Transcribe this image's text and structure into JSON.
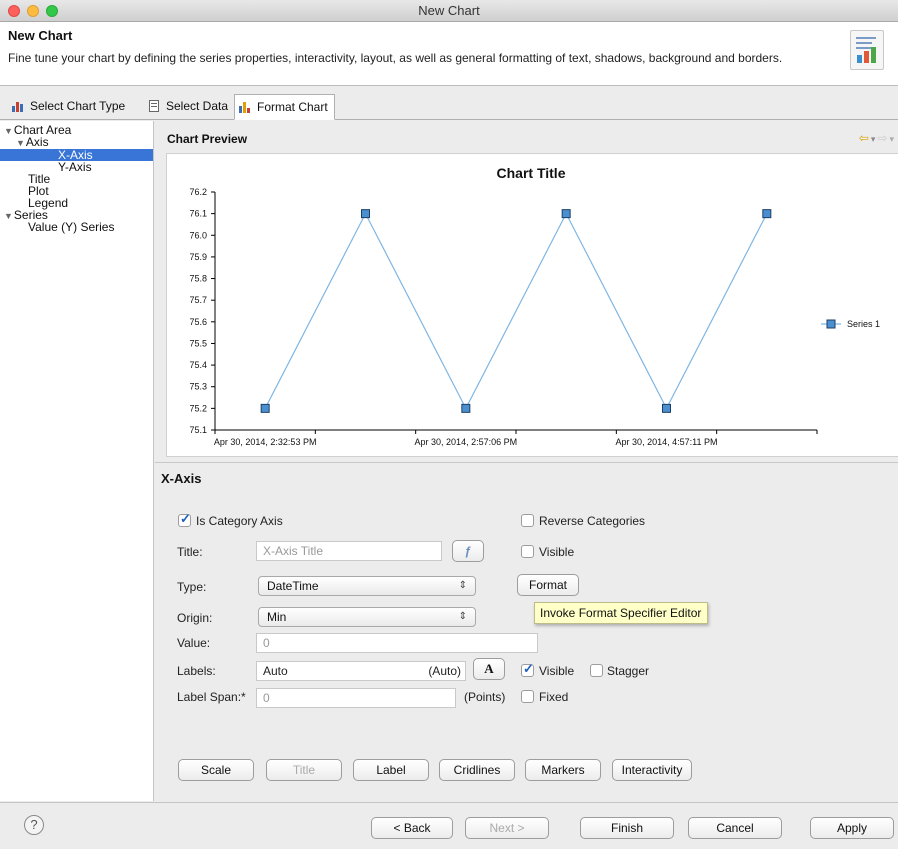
{
  "window": {
    "title": "New Chart"
  },
  "header": {
    "title": "New Chart",
    "description": "Fine tune your chart by defining the series properties, interactivity, layout, as well as general formatting of text, shadows, background and borders."
  },
  "tabs": [
    {
      "label": "Select Chart Type",
      "active": false
    },
    {
      "label": "Select Data",
      "active": false
    },
    {
      "label": "Format Chart",
      "active": true
    }
  ],
  "tree": [
    {
      "label": "Chart Area",
      "expanded": true
    },
    {
      "label": "Axis",
      "expanded": true
    },
    {
      "label": "X-Axis",
      "selected": true
    },
    {
      "label": "Y-Axis"
    },
    {
      "label": "Title"
    },
    {
      "label": "Plot"
    },
    {
      "label": "Legend"
    },
    {
      "label": "Series",
      "expanded": true
    },
    {
      "label": "Value (Y) Series"
    }
  ],
  "preview": {
    "label": "Chart Preview"
  },
  "chart_data": {
    "type": "line",
    "title": "Chart Title",
    "x_tick_labels": [
      "Apr 30, 2014, 2:32:53 PM",
      "Apr 30, 2014, 2:57:06 PM",
      "Apr 30, 2014, 4:57:11 PM"
    ],
    "y_tick_labels": [
      "75.1",
      "75.2",
      "75.3",
      "75.4",
      "75.5",
      "75.6",
      "75.7",
      "75.8",
      "75.9",
      "76.0",
      "76.1",
      "76.2"
    ],
    "ylim": [
      75.1,
      76.2
    ],
    "series": [
      {
        "name": "Series 1",
        "values": [
          75.2,
          76.1,
          75.2,
          76.1,
          75.2,
          76.1
        ],
        "color": "#7fb6e3",
        "marker_color": "#4a90d0"
      }
    ],
    "legend": "right",
    "grid": false
  },
  "section": {
    "title": "X-Axis"
  },
  "form": {
    "is_category_axis": {
      "label": "Is Category Axis",
      "checked": true
    },
    "reverse_categories": {
      "label": "Reverse Categories",
      "checked": false
    },
    "title": {
      "label": "Title:",
      "placeholder": "X-Axis Title"
    },
    "title_visible": {
      "label": "Visible",
      "checked": false
    },
    "type": {
      "label": "Type:",
      "value": "DateTime"
    },
    "format_button": "Format",
    "tooltip": "Invoke Format Specifier Editor",
    "origin": {
      "label": "Origin:",
      "value": "Min"
    },
    "value": {
      "label": "Value:",
      "value": "0"
    },
    "labels": {
      "label": "Labels:",
      "value": "Auto",
      "suffix": "(Auto)",
      "font_button": "A"
    },
    "labels_visible": {
      "label": "Visible",
      "checked": true
    },
    "stagger": {
      "label": "Stagger",
      "checked": false
    },
    "label_span": {
      "label": "Label Span:*",
      "value": "0",
      "suffix": "(Points)"
    },
    "fixed": {
      "label": "Fixed",
      "checked": false
    }
  },
  "sub_buttons": [
    "Scale",
    "Title",
    "Label",
    "Cridlines",
    "Markers",
    "Interactivity"
  ],
  "footer": {
    "help": "?",
    "back": "< Back",
    "next": "Next >",
    "finish": "Finish",
    "cancel": "Cancel",
    "apply": "Apply"
  }
}
